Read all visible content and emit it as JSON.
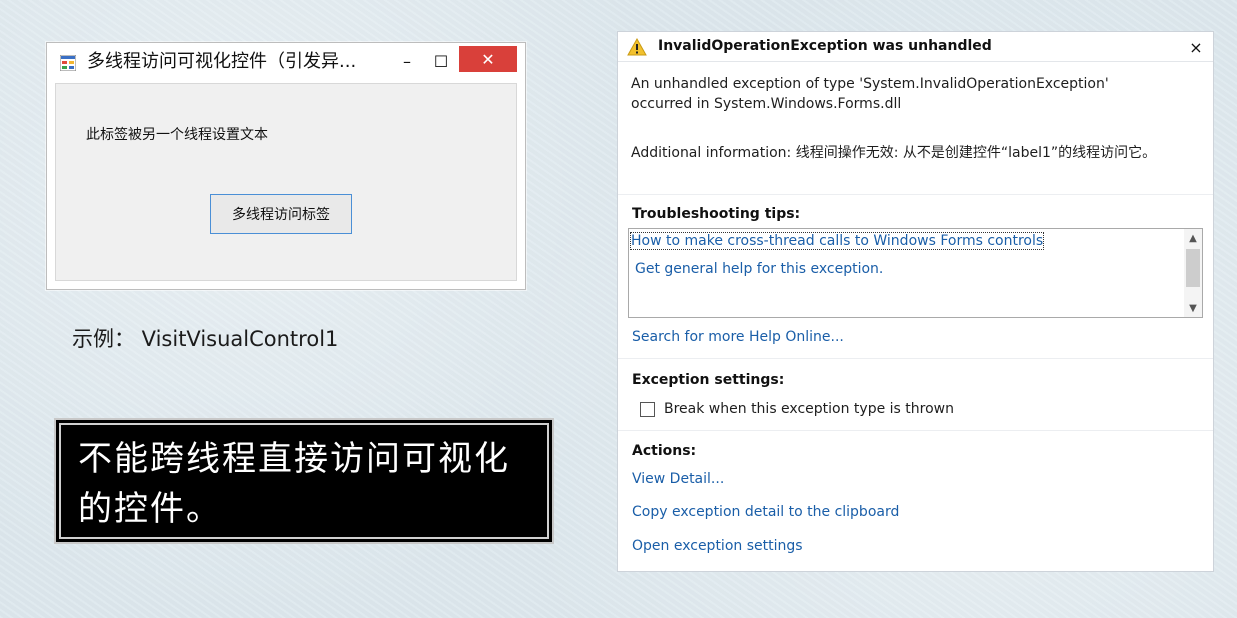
{
  "window": {
    "title": "多线程访问可视化控件（引发异...",
    "minimize_glyph": "–",
    "maximize_glyph": "☐",
    "close_glyph": "✕",
    "label_text": "此标签被另一个线程设置文本",
    "button_text": "多线程访问标签"
  },
  "example_caption": "示例： VisitVisualControl1",
  "note": {
    "text": "不能跨线程直接访问可视化的控件。"
  },
  "exception": {
    "title": "InvalidOperationException was unhandled",
    "close_glyph": "×",
    "description_line1": "An unhandled exception of type 'System.InvalidOperationException'",
    "description_line2": "occurred in System.Windows.Forms.dll",
    "additional_info": "Additional information: 线程间操作无效: 从不是创建控件“label1”的线程访问它。",
    "troubleshooting": {
      "heading": "Troubleshooting tips:",
      "tips": [
        "How to make cross-thread calls to Windows Forms controls",
        "Get general help for this exception."
      ],
      "search_link": "Search for more Help Online..."
    },
    "settings": {
      "heading": "Exception settings:",
      "checkbox_label": "Break when this exception type is thrown",
      "checked": false
    },
    "actions": {
      "heading": "Actions:",
      "items": [
        "View Detail...",
        "Copy exception detail to the clipboard",
        "Open exception settings"
      ]
    }
  },
  "icons": {
    "app_icon": "form-app-icon",
    "warning_icon": "warning-icon"
  },
  "colors": {
    "close_button": "#d9403a",
    "link": "#1a5ea8",
    "warning": "#f2c12e"
  }
}
